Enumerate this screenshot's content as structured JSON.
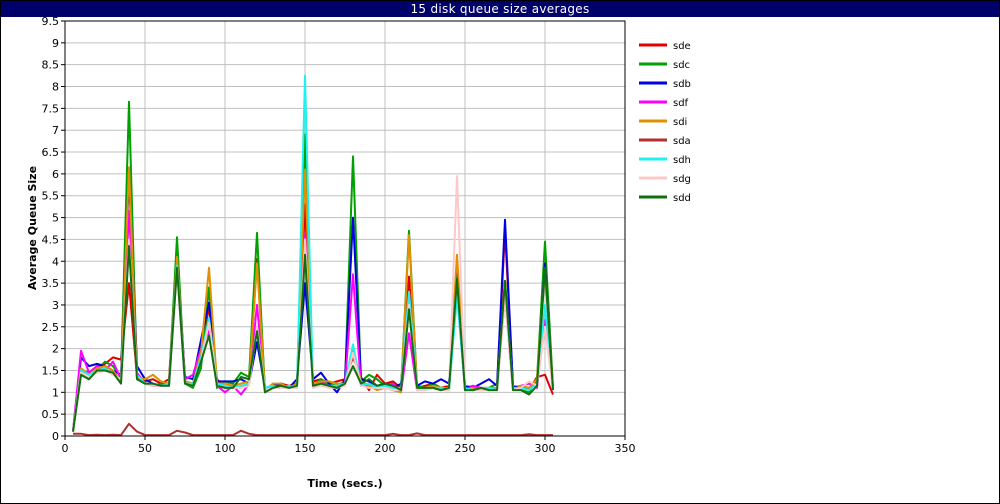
{
  "window": {
    "title": "15 disk queue size averages"
  },
  "chart_data": {
    "type": "line",
    "title": "15 disk queue size averages",
    "xlabel": "Time (secs.)",
    "ylabel": "Average Queue Size",
    "xlim": [
      0,
      350
    ],
    "ylim": [
      0,
      9.5
    ],
    "xticks": [
      0,
      50,
      100,
      150,
      200,
      250,
      300,
      350
    ],
    "yticks": [
      0,
      0.5,
      1,
      1.5,
      2,
      2.5,
      3,
      3.5,
      4,
      4.5,
      5,
      5.5,
      6,
      6.5,
      7,
      7.5,
      8,
      8.5,
      9,
      9.5
    ],
    "grid": true,
    "legend_position": "right",
    "x": [
      5,
      10,
      15,
      20,
      25,
      30,
      35,
      40,
      45,
      50,
      55,
      60,
      65,
      70,
      75,
      80,
      85,
      90,
      95,
      100,
      105,
      110,
      115,
      120,
      125,
      130,
      135,
      140,
      145,
      150,
      155,
      160,
      165,
      170,
      175,
      180,
      185,
      190,
      195,
      200,
      205,
      210,
      215,
      220,
      225,
      230,
      235,
      240,
      245,
      250,
      255,
      260,
      265,
      270,
      275,
      280,
      285,
      290,
      295,
      300,
      305
    ],
    "series": [
      {
        "name": "sde",
        "color": "#e00000",
        "values": [
          0.1,
          1.5,
          1.45,
          1.6,
          1.65,
          1.8,
          1.75,
          3.5,
          1.35,
          1.25,
          1.3,
          1.2,
          1.3,
          4.2,
          1.25,
          1.2,
          1.95,
          2.95,
          1.3,
          1.1,
          1.15,
          1.1,
          1.2,
          4.05,
          1.05,
          1.1,
          1.2,
          1.15,
          1.2,
          5.3,
          1.25,
          1.3,
          1.2,
          1.25,
          1.3,
          1.8,
          1.35,
          1.05,
          1.4,
          1.2,
          1.25,
          1.1,
          3.65,
          1.1,
          1.15,
          1.2,
          1.1,
          1.15,
          3.5,
          1.1,
          1.05,
          1.1,
          1.1,
          1.05,
          4.7,
          1.1,
          1.15,
          1.05,
          1.35,
          1.4,
          0.95
        ]
      },
      {
        "name": "sdc",
        "color": "#00a000",
        "values": [
          0.1,
          1.4,
          1.3,
          1.5,
          1.7,
          1.6,
          1.35,
          7.65,
          1.3,
          1.2,
          1.15,
          1.2,
          1.15,
          4.55,
          1.2,
          1.1,
          1.55,
          3.4,
          1.1,
          1.25,
          1.2,
          1.45,
          1.35,
          4.65,
          1.0,
          1.2,
          1.15,
          1.1,
          1.15,
          6.9,
          1.15,
          1.3,
          1.2,
          1.15,
          1.25,
          6.4,
          1.25,
          1.4,
          1.3,
          1.15,
          1.2,
          1.05,
          4.7,
          1.15,
          1.1,
          1.2,
          1.1,
          1.05,
          3.4,
          1.1,
          1.15,
          1.05,
          1.1,
          1.2,
          3.55,
          1.1,
          1.05,
          1.0,
          1.3,
          4.45,
          1.1
        ]
      },
      {
        "name": "sdb",
        "color": "#0000e0",
        "values": [
          0.1,
          1.8,
          1.6,
          1.65,
          1.6,
          1.5,
          1.4,
          5.95,
          1.6,
          1.3,
          1.2,
          1.15,
          1.2,
          4.05,
          1.35,
          1.3,
          2.2,
          3.05,
          1.25,
          1.25,
          1.25,
          1.3,
          1.2,
          2.15,
          1.1,
          1.15,
          1.2,
          1.1,
          1.3,
          3.5,
          1.3,
          1.45,
          1.2,
          1.0,
          1.3,
          5.0,
          1.3,
          1.25,
          1.15,
          1.2,
          1.1,
          1.2,
          3.0,
          1.15,
          1.25,
          1.2,
          1.3,
          1.2,
          3.75,
          1.15,
          1.1,
          1.2,
          1.3,
          1.15,
          4.95,
          1.15,
          1.1,
          1.1,
          1.2,
          3.95,
          1.05
        ]
      },
      {
        "name": "sdf",
        "color": "#ff00ff",
        "values": [
          0.1,
          1.95,
          1.45,
          1.6,
          1.5,
          1.7,
          1.3,
          5.15,
          1.45,
          1.2,
          1.15,
          1.15,
          1.2,
          3.9,
          1.3,
          1.4,
          2.0,
          2.4,
          1.15,
          1.0,
          1.15,
          0.95,
          1.2,
          3.0,
          1.05,
          1.1,
          1.15,
          1.1,
          1.2,
          4.6,
          1.2,
          1.25,
          1.15,
          1.1,
          1.2,
          3.7,
          1.15,
          1.2,
          1.1,
          1.15,
          1.2,
          1.0,
          2.35,
          1.05,
          1.1,
          1.1,
          1.05,
          1.1,
          3.3,
          1.05,
          1.15,
          1.1,
          1.05,
          1.1,
          3.2,
          1.05,
          1.15,
          1.2,
          1.1,
          2.65,
          1.05
        ]
      },
      {
        "name": "sdi",
        "color": "#e09000",
        "values": [
          0.1,
          1.55,
          1.4,
          1.55,
          1.6,
          1.5,
          1.25,
          6.15,
          1.35,
          1.3,
          1.4,
          1.25,
          1.2,
          4.1,
          1.25,
          1.2,
          1.9,
          3.85,
          1.2,
          1.2,
          1.15,
          1.2,
          1.25,
          3.95,
          1.05,
          1.2,
          1.2,
          1.1,
          1.2,
          6.1,
          1.2,
          1.25,
          1.25,
          1.2,
          1.2,
          2.0,
          1.25,
          1.15,
          1.05,
          1.1,
          1.05,
          1.0,
          4.6,
          1.1,
          1.1,
          1.15,
          1.1,
          1.1,
          4.15,
          1.05,
          1.1,
          1.05,
          1.1,
          1.1,
          3.5,
          1.05,
          1.15,
          1.1,
          1.3,
          3.8,
          1.1
        ]
      },
      {
        "name": "sda",
        "color": "#b03030",
        "values": [
          0.05,
          0.05,
          0.02,
          0.03,
          0.02,
          0.03,
          0.02,
          0.28,
          0.1,
          0.02,
          0.02,
          0.02,
          0.02,
          0.12,
          0.08,
          0.02,
          0.02,
          0.02,
          0.02,
          0.02,
          0.02,
          0.12,
          0.05,
          0.02,
          0.02,
          0.02,
          0.02,
          0.02,
          0.02,
          0.02,
          0.02,
          0.02,
          0.02,
          0.02,
          0.02,
          0.02,
          0.02,
          0.02,
          0.02,
          0.02,
          0.05,
          0.02,
          0.02,
          0.06,
          0.02,
          0.02,
          0.02,
          0.02,
          0.02,
          0.02,
          0.02,
          0.02,
          0.02,
          0.02,
          0.02,
          0.02,
          0.02,
          0.04,
          0.02,
          0.02,
          0.02
        ]
      },
      {
        "name": "sdh",
        "color": "#20f0f0",
        "values": [
          0.1,
          1.5,
          1.4,
          1.5,
          1.55,
          1.4,
          1.3,
          4.4,
          1.4,
          1.2,
          1.2,
          1.15,
          1.2,
          3.9,
          1.2,
          1.2,
          1.8,
          2.7,
          1.2,
          1.15,
          1.1,
          1.15,
          1.2,
          2.5,
          1.1,
          1.15,
          1.1,
          1.15,
          1.1,
          8.25,
          1.1,
          1.2,
          1.15,
          1.15,
          1.2,
          2.1,
          1.15,
          1.2,
          1.1,
          1.15,
          1.1,
          1.1,
          3.3,
          1.1,
          1.05,
          1.1,
          1.1,
          1.05,
          3.2,
          1.1,
          1.05,
          1.1,
          1.1,
          1.05,
          3.4,
          1.1,
          1.1,
          1.05,
          1.2,
          3.0,
          1.05
        ]
      },
      {
        "name": "sdg",
        "color": "#ffc8c8",
        "values": [
          0.1,
          1.45,
          1.35,
          1.45,
          1.5,
          1.4,
          1.3,
          4.5,
          1.3,
          1.2,
          1.15,
          1.15,
          1.15,
          3.8,
          1.2,
          1.15,
          1.7,
          2.6,
          1.15,
          1.1,
          1.1,
          1.1,
          1.15,
          2.5,
          1.05,
          1.1,
          1.1,
          1.1,
          1.1,
          4.5,
          1.1,
          1.15,
          1.1,
          1.1,
          1.15,
          1.9,
          1.15,
          1.1,
          1.1,
          1.1,
          1.05,
          1.05,
          3.0,
          1.05,
          1.05,
          1.1,
          1.05,
          1.05,
          5.95,
          1.05,
          1.05,
          1.05,
          1.05,
          1.05,
          3.2,
          1.05,
          1.1,
          1.25,
          1.15,
          2.5,
          1.05
        ]
      },
      {
        "name": "sdd",
        "color": "#107010",
        "values": [
          0.1,
          1.4,
          1.3,
          1.5,
          1.5,
          1.45,
          1.2,
          4.35,
          1.3,
          1.2,
          1.2,
          1.15,
          1.15,
          3.85,
          1.2,
          1.15,
          1.7,
          2.3,
          1.15,
          1.1,
          1.1,
          1.35,
          1.3,
          2.4,
          1.0,
          1.1,
          1.15,
          1.1,
          1.15,
          4.15,
          1.15,
          1.2,
          1.15,
          1.1,
          1.2,
          1.6,
          1.2,
          1.3,
          1.15,
          1.2,
          1.15,
          1.05,
          2.9,
          1.1,
          1.1,
          1.1,
          1.05,
          1.1,
          3.6,
          1.05,
          1.05,
          1.1,
          1.05,
          1.05,
          3.55,
          1.05,
          1.05,
          0.95,
          1.15,
          3.85,
          1.05
        ]
      }
    ]
  }
}
